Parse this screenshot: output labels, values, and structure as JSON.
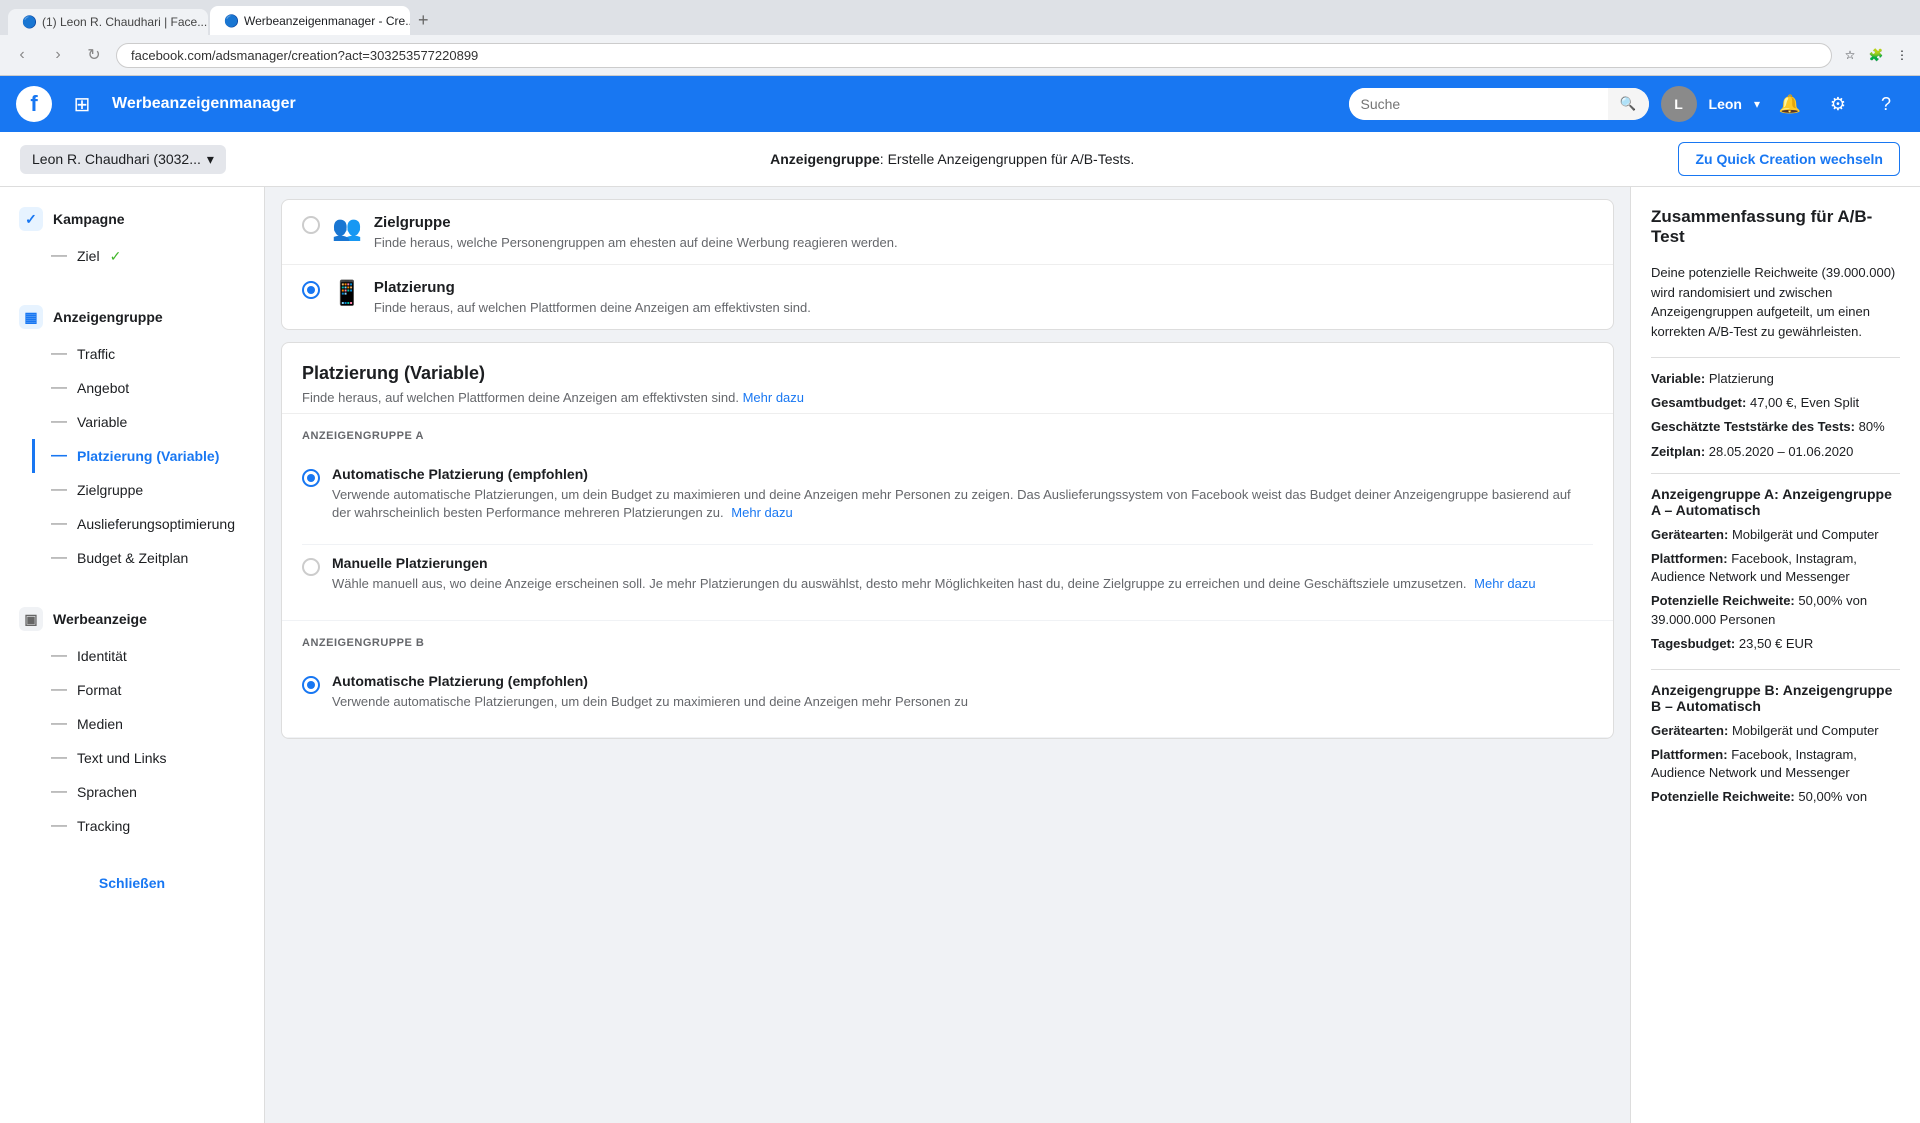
{
  "browser": {
    "tabs": [
      {
        "label": "(1) Leon R. Chaudhari | Face...",
        "active": false,
        "favicon": "🔵"
      },
      {
        "label": "Werbeanzeigenmanager - Cre...",
        "active": true,
        "favicon": "🔵"
      }
    ],
    "address": "facebook.com/adsmanager/creation?act=303253577220899"
  },
  "header": {
    "app_name": "Werbeanzeigenmanager",
    "search_placeholder": "Suche",
    "user_name": "Leon",
    "account_selector": "Leon R. Chaudhari (3032...",
    "breadcrumb_label": "Anzeigengruppe",
    "breadcrumb_text": ": Erstelle Anzeigengruppen für A/B-Tests.",
    "quick_creation_btn": "Zu Quick Creation wechseln"
  },
  "sidebar": {
    "campaign_label": "Kampagne",
    "campaign_sub": [
      {
        "label": "Ziel",
        "status": "check",
        "active": false
      }
    ],
    "adgroup_label": "Anzeigengruppe",
    "adgroup_sub": [
      {
        "label": "Traffic",
        "active": false
      },
      {
        "label": "Angebot",
        "active": false
      },
      {
        "label": "Variable",
        "active": false
      },
      {
        "label": "Platzierung (Variable)",
        "active": true
      },
      {
        "label": "Zielgruppe",
        "active": false
      },
      {
        "label": "Auslieferungsoptimierung",
        "active": false
      },
      {
        "label": "Budget & Zeitplan",
        "active": false
      }
    ],
    "ad_label": "Werbeanzeige",
    "ad_sub": [
      {
        "label": "Identität",
        "active": false
      },
      {
        "label": "Format",
        "active": false
      },
      {
        "label": "Medien",
        "active": false
      },
      {
        "label": "Text und Links",
        "active": false
      },
      {
        "label": "Sprachen",
        "active": false
      },
      {
        "label": "Tracking",
        "active": false
      }
    ],
    "close_btn": "Schließen"
  },
  "main": {
    "zielgruppe_option": {
      "title": "Zielgruppe",
      "desc": "Finde heraus, welche Personengruppen am ehesten auf deine Werbung reagieren werden."
    },
    "platzierung_option": {
      "title": "Platzierung",
      "desc": "Finde heraus, auf welchen Plattformen deine Anzeigen am effektivsten sind.",
      "selected": true
    },
    "variable_section": {
      "title": "Platzierung (Variable)",
      "desc": "Finde heraus, auf welchen Plattformen deine Anzeigen am effektivsten sind.",
      "mehr_dazu": "Mehr dazu",
      "group_a_label": "ANZEIGENGRUPPE A",
      "group_b_label": "ANZEIGENGRUPPE B",
      "auto_placement": {
        "title": "Automatische Platzierung (empfohlen)",
        "desc": "Verwende automatische Platzierungen, um dein Budget zu maximieren und deine Anzeigen mehr Personen zu zeigen. Das Auslieferungssystem von Facebook weist das Budget deiner Anzeigengruppe basierend auf der wahrscheinlich besten Performance mehreren Platzierungen zu.",
        "mehr_dazu": "Mehr dazu",
        "selected": true
      },
      "manual_placement": {
        "title": "Manuelle Platzierungen",
        "desc": "Wähle manuell aus, wo deine Anzeige erscheinen soll. Je mehr Platzierungen du auswählst, desto mehr Möglichkeiten hast du, deine Zielgruppe zu erreichen und deine Geschäftsziele umzusetzen.",
        "mehr_dazu": "Mehr dazu",
        "selected": false
      },
      "group_b_auto_title": "Automatische Platzierung (empfohlen)",
      "group_b_auto_desc": "Verwende automatische Platzierungen, um dein Budget zu maximieren und deine Anzeigen mehr Personen zu"
    }
  },
  "right_panel": {
    "title": "Zusammenfassung für A/B-Test",
    "desc": "Deine potenzielle Reichweite (39.000.000) wird randomisiert und zwischen Anzeigengruppen aufgeteilt, um einen korrekten A/B-Test zu gewährleisten.",
    "variable_label": "Variable:",
    "variable_value": "Platzierung",
    "budget_label": "Gesamtbudget:",
    "budget_value": "47,00 €, Even Split",
    "test_strength_label": "Geschätzte Teststärke des Tests:",
    "test_strength_value": "80%",
    "schedule_label": "Zeitplan:",
    "schedule_value": "28.05.2020 – 01.06.2020",
    "group_a": {
      "title": "Anzeigengruppe A:",
      "title_value": "Anzeigengruppe A – Automatisch",
      "geraeten_label": "Gerätearten:",
      "geraeten_value": "Mobilgerät und Computer",
      "plattformen_label": "Plattformen:",
      "plattformen_value": "Facebook, Instagram, Audience Network und Messenger",
      "reichweite_label": "Potenzielle Reichweite:",
      "reichweite_value": "50,00% von 39.000.000 Personen",
      "tagesbudget_label": "Tagesbudget:",
      "tagesbudget_value": "23,50 € EUR"
    },
    "group_b": {
      "title": "Anzeigengruppe B:",
      "title_value": "Anzeigengruppe B – Automatisch",
      "geraeten_label": "Gerätearten:",
      "geraeten_value": "Mobilgerät und Computer",
      "plattformen_label": "Plattformen:",
      "plattformen_value": "Facebook, Instagram, Audience Network und Messenger",
      "reichweite_label": "Potenzielle Reichweite:",
      "reichweite_value": "50,00% von"
    }
  },
  "colors": {
    "facebook_blue": "#1877f2",
    "active_blue": "#1877f2",
    "text_primary": "#1c1e21",
    "text_secondary": "#65676b",
    "border": "#ddd",
    "bg": "#f0f2f5"
  }
}
